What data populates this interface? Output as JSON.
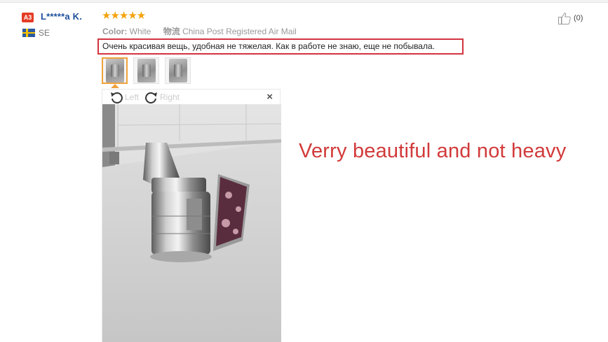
{
  "review": {
    "level_badge": "A3",
    "user_name": "L*****a K.",
    "country": "SE",
    "rating": 5,
    "stars": "★★★★★",
    "color_key": "Color:",
    "color_value": "White",
    "shipping_icon_text": "物流",
    "shipping_value": "China Post Registered Air Mail",
    "text": "Очень красивая вещь, удобная не тяжелая. Как в работе не знаю, еще не побывала.",
    "helpful_count": "(0)",
    "thumbnails": [
      "photo-1",
      "photo-2",
      "photo-3"
    ]
  },
  "viewer": {
    "rotate_left_label": "Left",
    "rotate_right_label": "Right",
    "close_label": "×"
  },
  "annotation": "Verry beautiful and not heavy",
  "colors": {
    "brand_link": "#1d4f9c",
    "star": "#f3a30d",
    "highlight_border": "#d2343f",
    "annotation": "#d23a3a",
    "badge": "#e43c25"
  }
}
